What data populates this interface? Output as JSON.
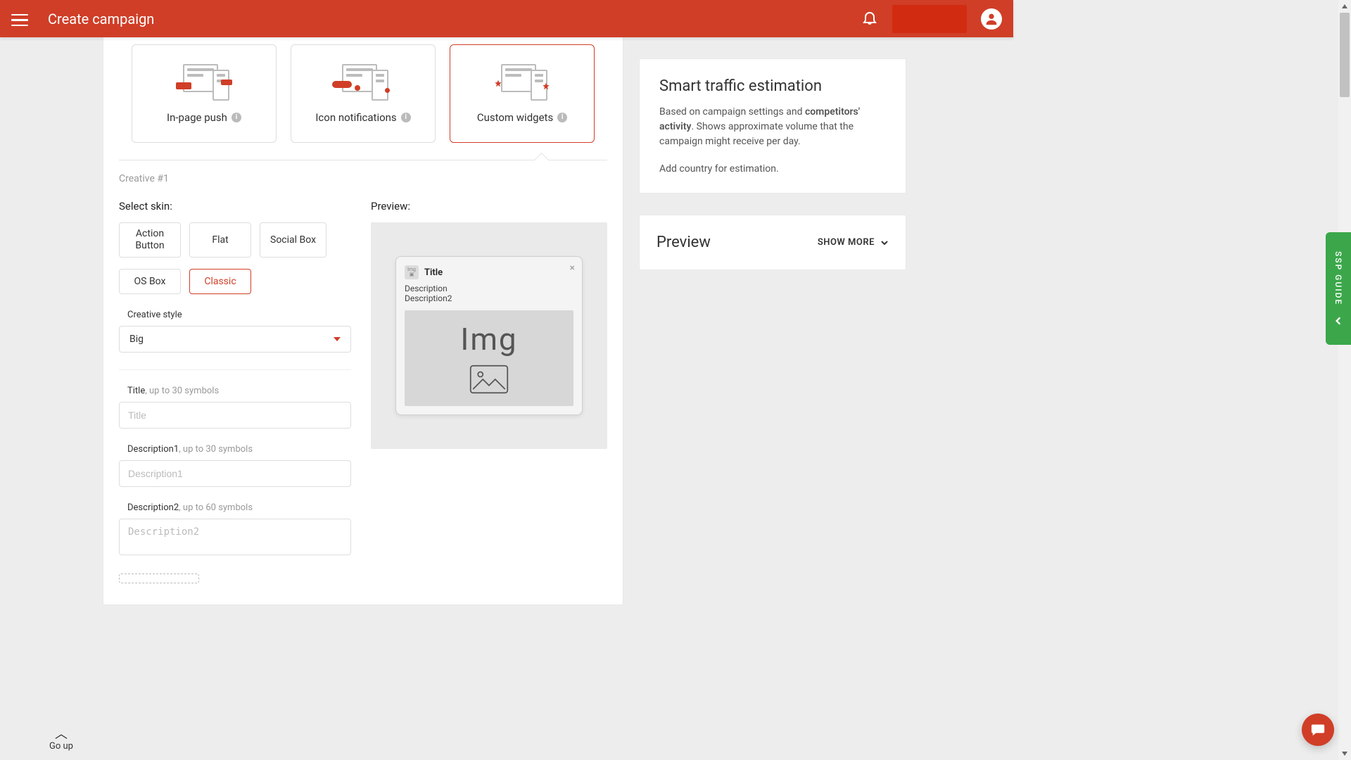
{
  "header": {
    "title": "Create campaign"
  },
  "cards": [
    {
      "label": "In-page push",
      "selected": false
    },
    {
      "label": "Icon notifications",
      "selected": false
    },
    {
      "label": "Custom widgets",
      "selected": true
    }
  ],
  "creative": {
    "badge": "Creative #1",
    "select_skin_label": "Select skin:",
    "skins": [
      {
        "label": "Action Button",
        "twoline": true
      },
      {
        "label": "Flat"
      },
      {
        "label": "Social Box"
      },
      {
        "label": "OS Box"
      },
      {
        "label": "Classic",
        "selected": true
      }
    ],
    "style_label": "Creative style",
    "style_value": "Big",
    "title_label": "Title",
    "title_hint": ", up to 30 symbols",
    "title_placeholder": "Title",
    "desc1_label": "Description1",
    "desc1_hint": ", up to 30 symbols",
    "desc1_placeholder": "Description1",
    "desc2_label": "Description2",
    "desc2_hint": ", up to 60 symbols",
    "desc2_placeholder": "Description2"
  },
  "preview": {
    "label": "Preview:",
    "title": "Title",
    "desc": "Description",
    "desc2": "Description2",
    "img_text": "Img"
  },
  "estimation": {
    "title": "Smart traffic estimation",
    "text_pre": "Based on campaign settings and ",
    "text_bold": "competitors' activity",
    "text_post": ". Shows approximate volume that the campaign might receive per day.",
    "sub": "Add country for estimation."
  },
  "side_preview": {
    "title": "Preview",
    "show_more": "SHOW MORE"
  },
  "go_up": "Go up",
  "ssp_guide": "SSP GUIDE"
}
